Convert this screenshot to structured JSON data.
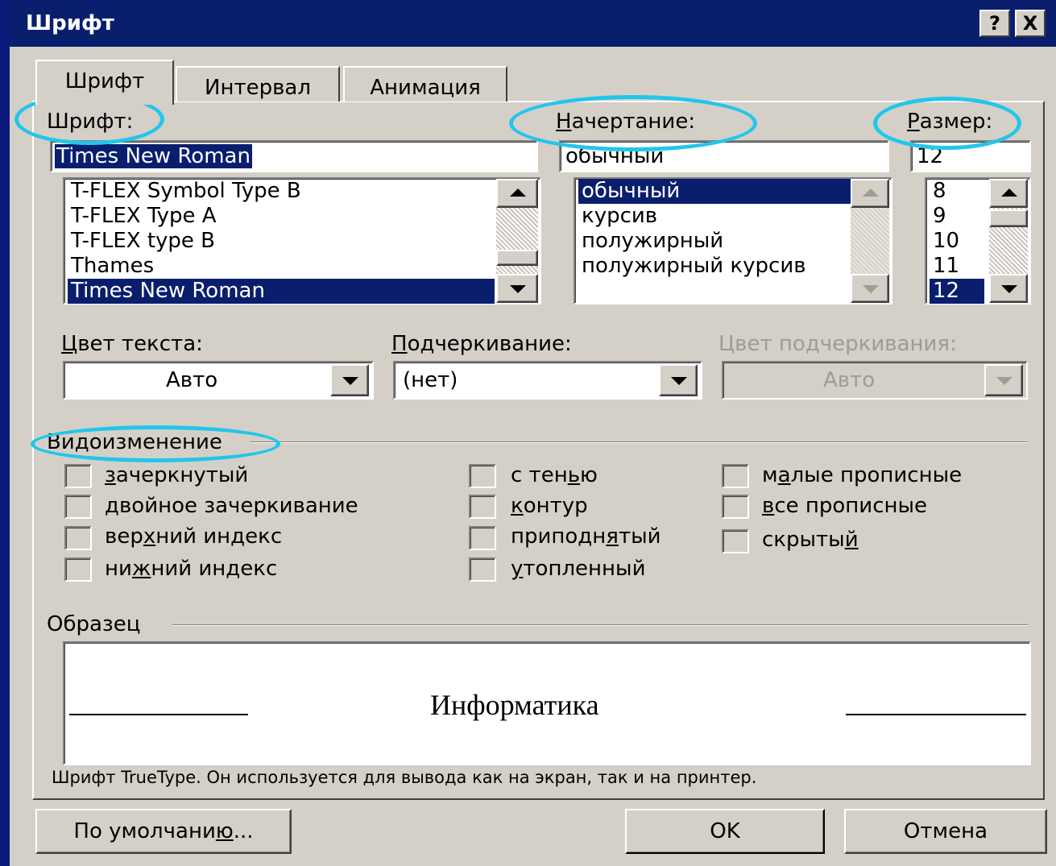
{
  "window": {
    "title": "Шрифт",
    "help_button": "?",
    "close_button": "X"
  },
  "tabs": [
    {
      "label": "Шрифт",
      "active": true
    },
    {
      "label": "Интервал",
      "active": false
    },
    {
      "label": "Анимация",
      "active": false
    }
  ],
  "font": {
    "label": "Шрифт:",
    "value": "Times New Roman",
    "list": [
      "T-FLEX Symbol Type B",
      "T-FLEX Type A",
      "T-FLEX type B",
      "Thames",
      "Times New Roman"
    ],
    "selected": "Times New Roman"
  },
  "style": {
    "label": "Начертание:",
    "value": "обычный",
    "list": [
      "обычный",
      "курсив",
      "полужирный",
      "полужирный курсив"
    ],
    "selected": "обычный"
  },
  "size": {
    "label": "Размер:",
    "value": "12",
    "list": [
      "8",
      "9",
      "10",
      "11",
      "12"
    ],
    "selected": "12"
  },
  "text_color": {
    "label": "Цвет текста:",
    "value": "Авто"
  },
  "underline": {
    "label": "Подчеркивание:",
    "value": "(нет)"
  },
  "underline_color": {
    "label": "Цвет подчеркивания:",
    "value": "Авто",
    "disabled": true
  },
  "effects": {
    "label": "Видоизменение",
    "items": [
      {
        "label": "зачеркнутый",
        "checked": false
      },
      {
        "label": "двойное зачеркивание",
        "checked": false
      },
      {
        "label": "верхний индекс",
        "checked": false
      },
      {
        "label": "нижний индекс",
        "checked": false
      },
      {
        "label": "с тенью",
        "checked": false
      },
      {
        "label": "контур",
        "checked": false
      },
      {
        "label": "приподнятый",
        "checked": false
      },
      {
        "label": "утопленный",
        "checked": false
      },
      {
        "label": "малые прописные",
        "checked": false
      },
      {
        "label": "все прописные",
        "checked": false
      },
      {
        "label": "скрытый",
        "checked": false
      }
    ]
  },
  "preview": {
    "label": "Образец",
    "sample_text": "Информатика",
    "description": "Шрифт TrueType. Он используется для вывода как на экран, так и на принтер."
  },
  "buttons": {
    "default": "По умолчанию...",
    "ok": "OK",
    "cancel": "Отмена"
  },
  "colors": {
    "titlebar": "#0a1e6e",
    "dialog_bg": "#d4d0c8",
    "selection": "#0a1e6e",
    "highlight_ellipse": "#22c6ea",
    "disabled_text": "#a09c94"
  }
}
